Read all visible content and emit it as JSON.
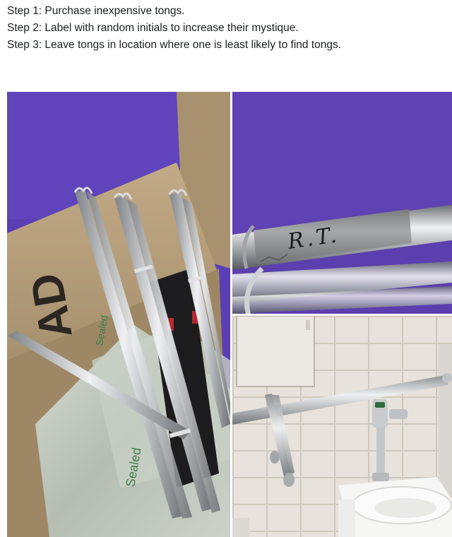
{
  "post": {
    "steps": [
      "Step 1: Purchase inexpensive tongs.",
      "Step 2: Label with random initials to increase their mystique.",
      "Step 3: Leave tongs in location where one is least likely to find tongs."
    ]
  },
  "photos": {
    "box": {
      "box_text": "AD",
      "bag_text_1": "Sealed",
      "bag_text_2": "Sealed"
    },
    "label": {
      "initials": "R.T."
    }
  },
  "colors": {
    "purple_wall": "#5a3fb4",
    "cardboard": "#b69f7e",
    "steel": "#c9cbce",
    "tile": "#e6e2dc",
    "tape": "#8f9090"
  }
}
